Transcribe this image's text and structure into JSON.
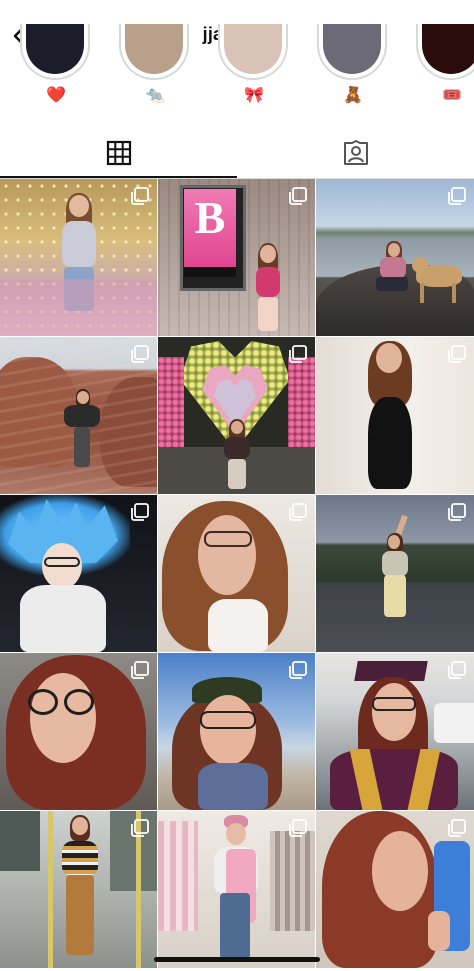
{
  "header": {
    "username": "jjasarys",
    "back_icon": "chevron-left-icon",
    "more_icon": "ellipsis-icon"
  },
  "highlights": [
    {
      "emoji": "❤️",
      "tint": "#1c1c2a"
    },
    {
      "emoji": "🐀",
      "tint": "#b9a08a"
    },
    {
      "emoji": "🎀",
      "tint": "#d9c2b6"
    },
    {
      "emoji": "🧸",
      "tint": "#6d6a78"
    },
    {
      "emoji": "🎟️",
      "tint": "#2a0c0c"
    }
  ],
  "tabs": [
    {
      "name": "posts-grid",
      "icon": "grid-icon",
      "active": true
    },
    {
      "name": "tagged",
      "icon": "tagged-person-icon",
      "active": false
    }
  ],
  "grid": [
    {
      "theme": "bedroom-fairy-lights",
      "multi": true
    },
    {
      "theme": "barbie-poster",
      "multi": true
    },
    {
      "theme": "lake-with-dog",
      "multi": true
    },
    {
      "theme": "red-rocks",
      "multi": true
    },
    {
      "theme": "flower-heart-arch",
      "multi": true
    },
    {
      "theme": "black-dress",
      "multi": true
    },
    {
      "theme": "blue-wig",
      "multi": true
    },
    {
      "theme": "selfie-closeup",
      "multi": true
    },
    {
      "theme": "evening-road",
      "multi": true
    },
    {
      "theme": "glasses-selfie",
      "multi": true
    },
    {
      "theme": "beach-cap",
      "multi": true
    },
    {
      "theme": "graduation",
      "multi": true
    },
    {
      "theme": "train-pose",
      "multi": true
    },
    {
      "theme": "clothing-store",
      "multi": true
    },
    {
      "theme": "mirror-selfie",
      "multi": true
    }
  ],
  "colors": {
    "text": "#111111",
    "divider": "#dbdbdb",
    "background": "#ffffff"
  }
}
